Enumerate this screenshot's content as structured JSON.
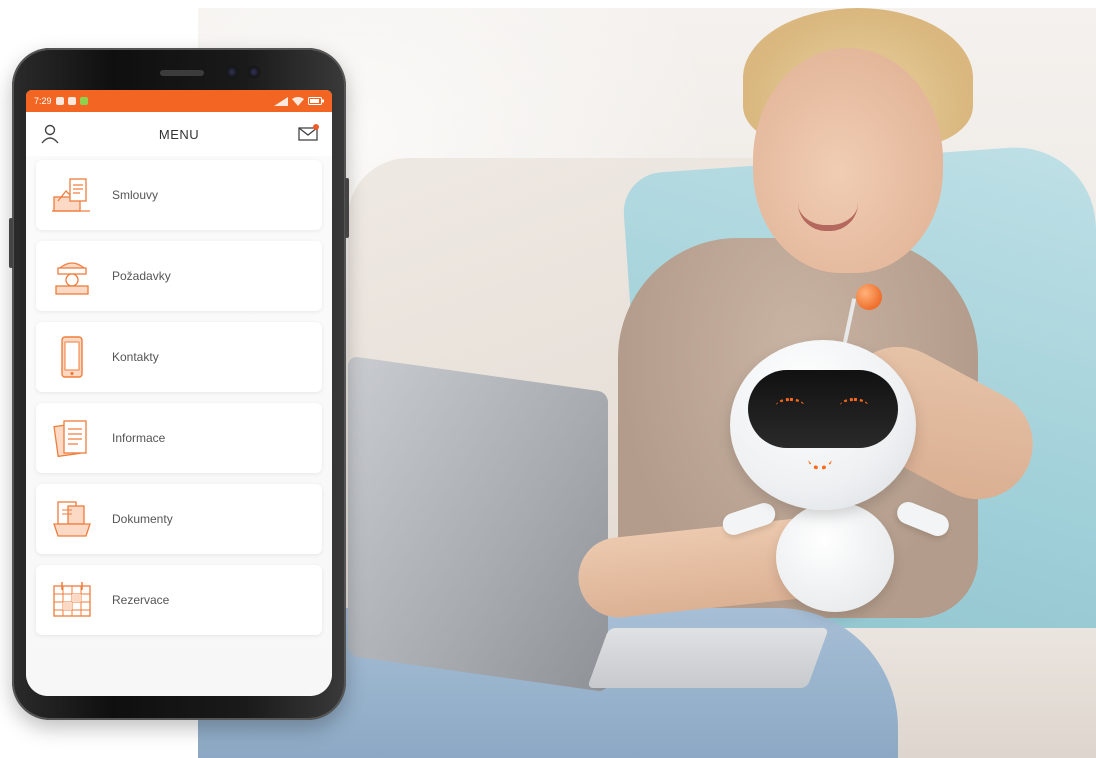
{
  "status_bar": {
    "time": "7:29"
  },
  "header": {
    "title": "MENU",
    "profile_icon": "user-icon",
    "mail_icon": "mail-icon"
  },
  "menu": {
    "items": [
      {
        "label": "Smlouvy",
        "icon": "contract-icon"
      },
      {
        "label": "Požadavky",
        "icon": "requests-icon"
      },
      {
        "label": "Kontakty",
        "icon": "phone-contact-icon"
      },
      {
        "label": "Informace",
        "icon": "information-icon"
      },
      {
        "label": "Dokumenty",
        "icon": "documents-icon"
      },
      {
        "label": "Rezervace",
        "icon": "reservation-icon"
      }
    ]
  },
  "colors": {
    "accent": "#f26522",
    "icon_stroke": "#ef7d3c",
    "notification": "#f15a29"
  }
}
